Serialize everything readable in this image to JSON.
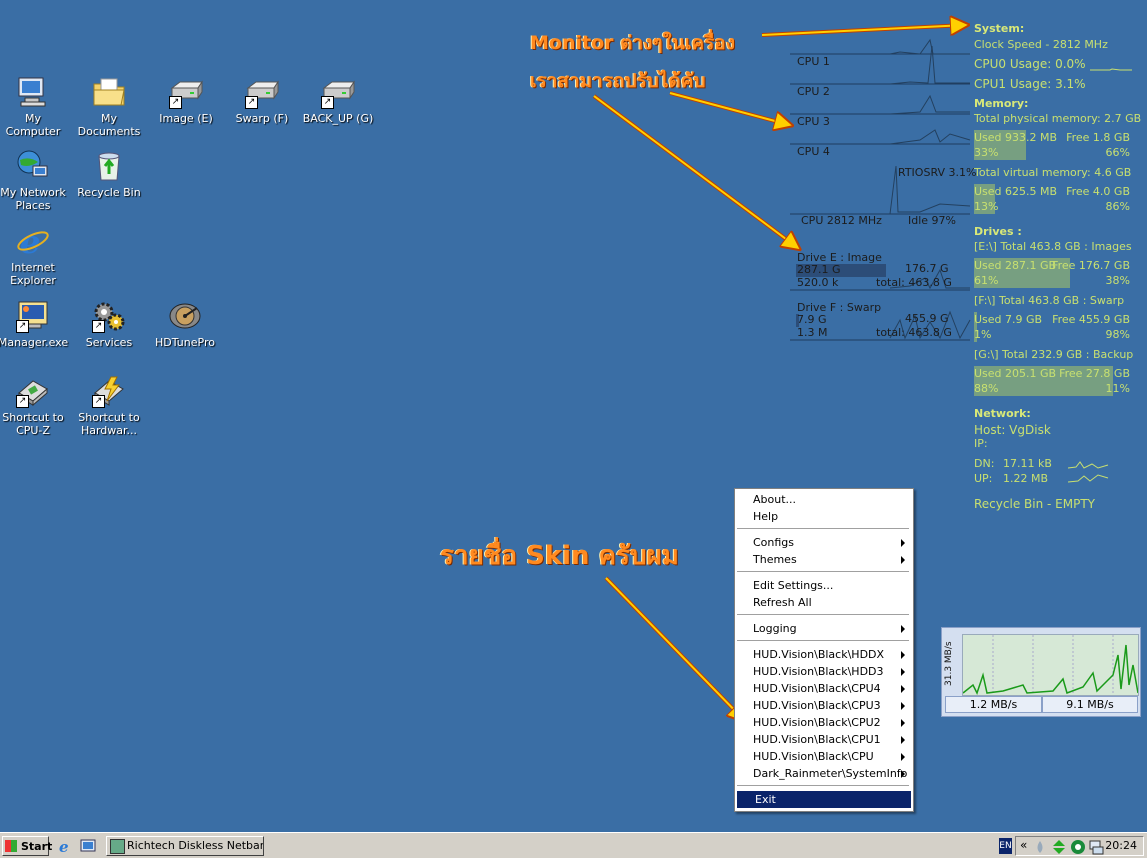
{
  "desktop_icons": [
    {
      "label": "My Computer",
      "icon": "my-computer-icon"
    },
    {
      "label": "My Documents",
      "icon": "my-documents-icon"
    },
    {
      "label": "Image (E)",
      "icon": "drive-icon"
    },
    {
      "label": "Swarp (F)",
      "icon": "drive-icon"
    },
    {
      "label": "BACK_UP (G)",
      "icon": "drive-icon"
    },
    {
      "label": "My Network Places",
      "icon": "network-places-icon"
    },
    {
      "label": "Recycle Bin",
      "icon": "recycle-bin-icon"
    },
    {
      "label": "Internet Explorer",
      "icon": "internet-explorer-icon"
    },
    {
      "label": "Manager.exe",
      "icon": "manager-exe-icon"
    },
    {
      "label": "Services",
      "icon": "services-icon"
    },
    {
      "label": "HDTunePro",
      "icon": "hdtunepro-icon"
    },
    {
      "label": "Shortcut to CPU-Z",
      "icon": "cpu-z-icon"
    },
    {
      "label": "Shortcut to Hardwar...",
      "icon": "hardware-icon"
    }
  ],
  "annotations": {
    "monitor": "Monitor ต่างๆในเครื่อง",
    "adjust": "เราสามารถปรับได้คับ",
    "skin_list": "รายชื่อ Skin ครับผม"
  },
  "cpu_graph": {
    "labels": [
      "CPU 1",
      "CPU 2",
      "CPU 3",
      "CPU 4"
    ],
    "process": "RTIOSRV 3.1%",
    "clock": "CPU 2812 MHz",
    "idle": "Idle 97%"
  },
  "drive_graphs": [
    {
      "title": "Drive E : Image",
      "used": "287.1 G",
      "free": "176.7 G",
      "rate": "520.0 k",
      "total": "total: 463.8 G"
    },
    {
      "title": "Drive F : Swarp",
      "used": "7.9 G",
      "free": "455.9 G",
      "rate": "1.3 M",
      "total": "total: 463.8 G"
    }
  ],
  "sysinfo": {
    "system_header": "System:",
    "clock_speed": "Clock Speed - 2812 MHz",
    "cpu0": "CPU0 Usage: 0.0%",
    "cpu1": "CPU1 Usage: 3.1%",
    "memory_header": "Memory:",
    "phys_total": "Total physical memory: 2.7 GB",
    "phys_used": "Used 933.2 MB",
    "phys_free": "Free 1.8 GB",
    "phys_used_pct": "33%",
    "phys_free_pct": "66%",
    "virt_total": "Total virtual memory: 4.6 GB",
    "virt_used": "Used 625.5 MB",
    "virt_free": "Free 4.0 GB",
    "virt_used_pct": "13%",
    "virt_free_pct": "86%",
    "drives_header": "Drives :",
    "drives": [
      {
        "title": "[E:\\] Total 463.8 GB : Images",
        "used": "Used 287.1 GB",
        "free": "Free 176.7 GB",
        "used_pct": "61%",
        "free_pct": "38%",
        "fill": 0.61
      },
      {
        "title": "[F:\\] Total 463.8 GB : Swarp",
        "used": "Used 7.9 GB",
        "free": "Free 455.9 GB",
        "used_pct": "1%",
        "free_pct": "98%",
        "fill": 0.01
      },
      {
        "title": "[G:\\] Total 232.9 GB : Backup",
        "used": "Used 205.1 GB",
        "free": "Free 27.8 GB",
        "used_pct": "88%",
        "free_pct": "11%",
        "fill": 0.88
      }
    ],
    "network_header": "Network:",
    "host": "Host: VgDisk",
    "ip": "IP:",
    "dn": "DN:",
    "dn_val": "17.11 kB",
    "up": "UP:",
    "up_val": "1.22 MB",
    "recycle": "Recycle Bin - EMPTY"
  },
  "memory_fill": {
    "phys": 0.33,
    "virt": 0.13
  },
  "context_menu": {
    "about": "About...",
    "help": "Help",
    "configs": "Configs",
    "themes": "Themes",
    "edit_settings": "Edit Settings...",
    "refresh_all": "Refresh All",
    "logging": "Logging",
    "skins": [
      "HUD.Vision\\Black\\HDDX",
      "HUD.Vision\\Black\\HDD3",
      "HUD.Vision\\Black\\CPU4",
      "HUD.Vision\\Black\\CPU3",
      "HUD.Vision\\Black\\CPU2",
      "HUD.Vision\\Black\\CPU1",
      "HUD.Vision\\Black\\CPU",
      "Dark_Rainmeter\\SystemInfo"
    ],
    "exit": "Exit"
  },
  "net_widget": {
    "ylabel": "31.3 MB/s",
    "down": "1.2 MB/s",
    "up": "9.1 MB/s"
  },
  "taskbar": {
    "start": "Start",
    "task": "Richtech Diskless Netbar ...",
    "lang": "EN",
    "chevron": "«",
    "clock": "20:24"
  },
  "colors": {
    "desktop": "#3a6ea5",
    "skin_text": "#c8e070",
    "annotation": "#ff8a20",
    "menu_highlight": "#0a246a"
  }
}
